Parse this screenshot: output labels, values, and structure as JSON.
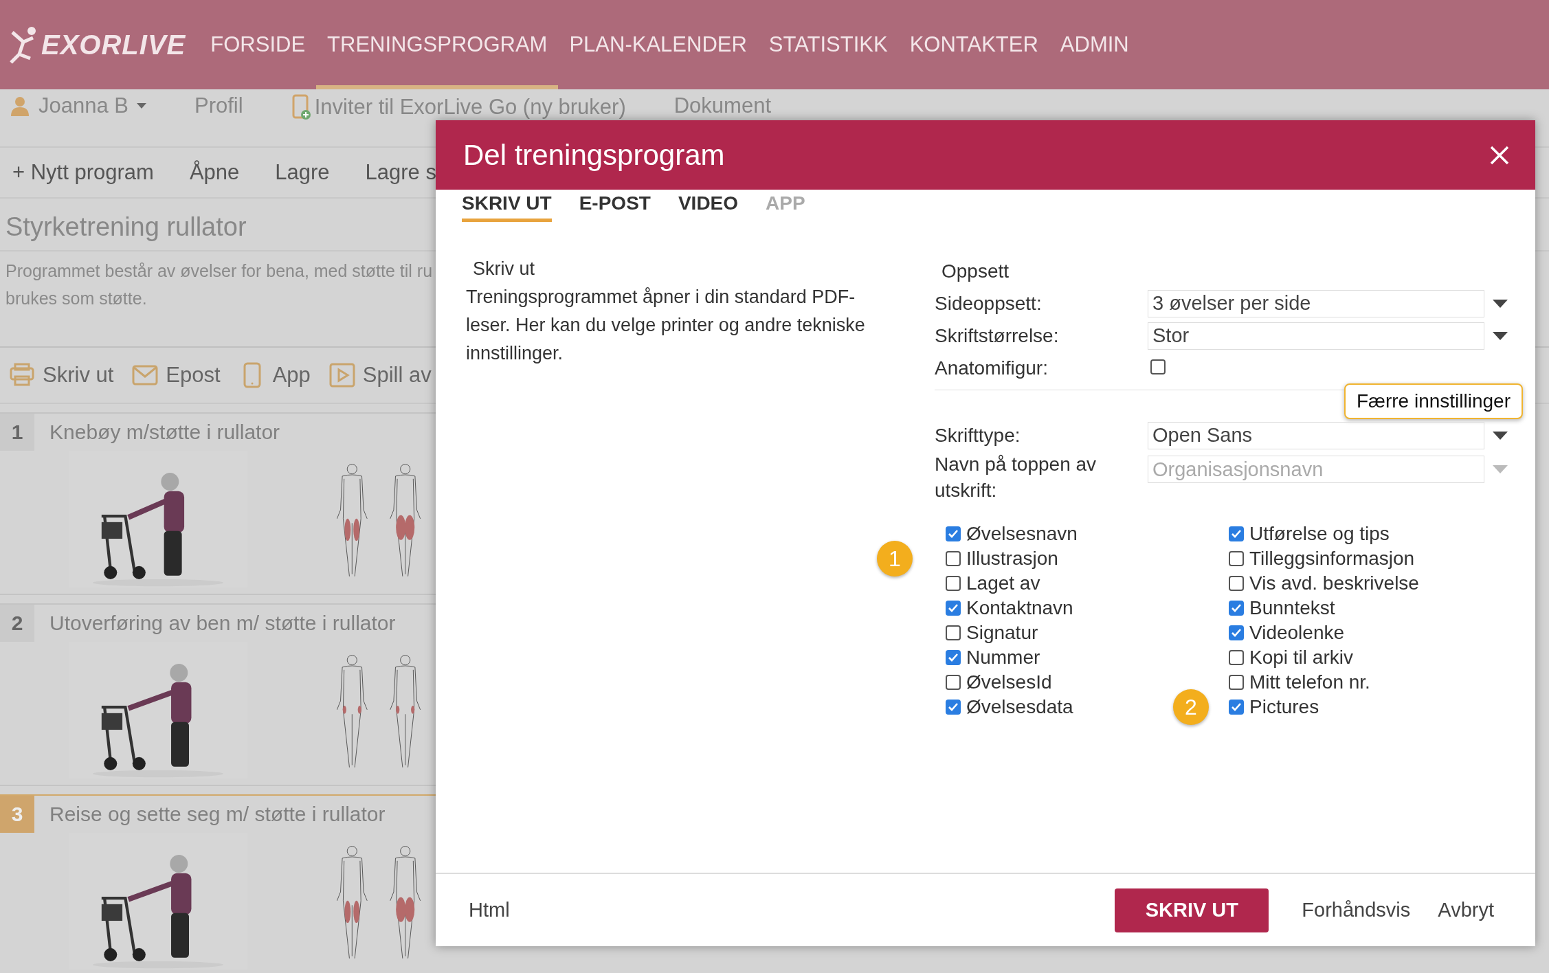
{
  "header": {
    "logo": "EXORLIVE",
    "nav": [
      {
        "label": "FORSIDE",
        "selected": false
      },
      {
        "label": "TRENINGSPROGRAM",
        "selected": true
      },
      {
        "label": "PLAN-KALENDER",
        "selected": false
      },
      {
        "label": "STATISTIKK",
        "selected": false
      },
      {
        "label": "KONTAKTER",
        "selected": false
      },
      {
        "label": "ADMIN",
        "selected": false
      }
    ]
  },
  "user_bar": {
    "user": "Joanna B",
    "profile": "Profil",
    "invite": "Inviter til ExorLive Go (ny bruker)",
    "document": "Dokument"
  },
  "toolbar": [
    "+ Nytt program",
    "Åpne",
    "Lagre",
    "Lagre s"
  ],
  "program": {
    "title": "Styrketrening rullator",
    "description": [
      "Programmet består av øvelser for bena, med støtte til ru",
      "brukes som støtte."
    ]
  },
  "actions": [
    {
      "kind": "print",
      "label": "Skriv ut"
    },
    {
      "kind": "mail",
      "label": "Epost"
    },
    {
      "kind": "phone",
      "label": "App"
    },
    {
      "kind": "play",
      "label": "Spill av"
    }
  ],
  "exercises": [
    {
      "number": "1",
      "title": "Knebøy m/støtte i rullator",
      "selected": false
    },
    {
      "number": "2",
      "title": "Utoverføring av ben m/ støtte i rullator",
      "selected": false
    },
    {
      "number": "3",
      "title": "Reise og sette seg m/ støtte i rullator",
      "selected": true
    }
  ],
  "dialog": {
    "title": "Del treningsprogram",
    "tabs": [
      {
        "label": "SKRIV UT",
        "selected": true,
        "disabled": false
      },
      {
        "label": "E-POST",
        "selected": false,
        "disabled": false
      },
      {
        "label": "VIDEO",
        "selected": false,
        "disabled": false
      },
      {
        "label": "APP",
        "selected": false,
        "disabled": true
      }
    ],
    "print_heading": "Skriv ut",
    "print_text": "Treningsprogrammet åpner i din standard PDF-leser. Her kan du velge printer og andre tekniske innstillinger.",
    "settings_heading": "Oppsett",
    "fields": [
      {
        "kind": "select",
        "label": "Sideoppsett:",
        "value": "3 øvelser per side"
      },
      {
        "kind": "select",
        "label": "Skriftstørrelse:",
        "value": "Stor"
      },
      {
        "kind": "checkbox",
        "label": "Anatomifigur:",
        "checked": false
      }
    ],
    "toggle_button": "Færre innstillinger",
    "more_fields": [
      {
        "kind": "select",
        "label": "Skrifttype:",
        "value": "Open Sans"
      },
      {
        "kind": "select",
        "label": "Navn på toppen av utskrift:",
        "placeholder": "Organisasjonsnavn"
      }
    ],
    "options_left": [
      {
        "label": "Øvelsesnavn",
        "checked": true
      },
      {
        "label": "Illustrasjon",
        "checked": false
      },
      {
        "label": "Laget av",
        "checked": false
      },
      {
        "label": "Kontaktnavn",
        "checked": true
      },
      {
        "label": "Signatur",
        "checked": false
      },
      {
        "label": "Nummer",
        "checked": true
      },
      {
        "label": "ØvelsesId",
        "checked": false
      },
      {
        "label": "Øvelsesdata",
        "checked": true
      }
    ],
    "options_right": [
      {
        "label": "Utførelse og tips",
        "checked": true
      },
      {
        "label": "Tilleggsinformasjon",
        "checked": false
      },
      {
        "label": "Vis avd. beskrivelse",
        "checked": false
      },
      {
        "label": "Bunntekst",
        "checked": true
      },
      {
        "label": "Videolenke",
        "checked": true
      },
      {
        "label": "Kopi til arkiv",
        "checked": false
      },
      {
        "label": "Mitt telefon nr.",
        "checked": false
      },
      {
        "label": "Pictures",
        "checked": true
      }
    ],
    "callouts": [
      "1",
      "2"
    ],
    "footer": {
      "html": "Html",
      "primary": "SKRIV UT",
      "buttons": [
        "Forhåndsvis",
        "Avbryt"
      ]
    }
  }
}
